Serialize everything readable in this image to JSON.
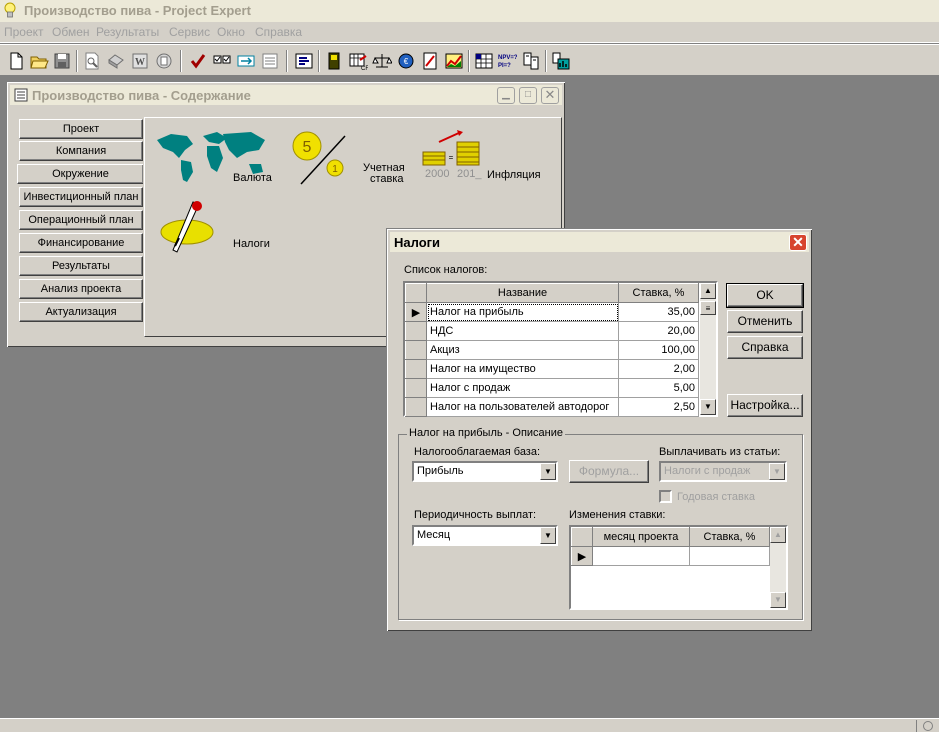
{
  "app": {
    "title": "Производство пива - Project Expert"
  },
  "menu": [
    "Проект",
    "Обмен",
    "Результаты",
    "Сервис",
    "Окно",
    "Справка"
  ],
  "toolbar_icons": [
    "new-icon",
    "open-icon",
    "save-icon",
    "preview-icon",
    "print-icon",
    "word-icon",
    "excel-icon",
    "check-icon",
    "checklist-icon",
    "calculate-icon",
    "notes-icon",
    "schedule-icon",
    "book-icon",
    "cashflow-icon",
    "balance-icon",
    "financial-icon",
    "results-icon",
    "chart-icon",
    "grid-icon",
    "npv-pi-icon",
    "gauge-icon",
    "dashboard-icon"
  ],
  "content_window": {
    "title": "Производство пива - Содержание",
    "nav": [
      "Проект",
      "Компания",
      "Окружение",
      "Инвестиционный план",
      "Операционный план",
      "Финансирование",
      "Результаты",
      "Анализ проекта",
      "Актуализация"
    ],
    "selected_index": 2,
    "panel": {
      "currency_label": "Валюта",
      "discount_label_1": "Учетная",
      "discount_label_2": "ставка",
      "inflation_label": "Инфляция",
      "year_start": "2000",
      "year_end": "201_",
      "coin_big": "5",
      "coin_small": "1",
      "taxes_label": "Налоги"
    }
  },
  "tax_dialog": {
    "title": "Налоги",
    "list_label": "Список налогов:",
    "columns": [
      "Название",
      "Ставка, %"
    ],
    "rows": [
      {
        "name": "Налог на прибыль",
        "rate": "35,00"
      },
      {
        "name": "НДС",
        "rate": "20,00"
      },
      {
        "name": "Акциз",
        "rate": "100,00"
      },
      {
        "name": "Налог на имущество",
        "rate": "2,00"
      },
      {
        "name": "Налог с продаж",
        "rate": "5,00"
      },
      {
        "name": "Налог на пользователей автодорог",
        "rate": "2,50"
      }
    ],
    "buttons": {
      "ok": "OK",
      "cancel": "Отменить",
      "help": "Справка",
      "settings": "Настройка..."
    },
    "desc_group": "Налог на прибыль - Описание",
    "tax_base_label": "Налогооблагаемая база:",
    "tax_base_value": "Прибыль",
    "formula_btn": "Формула...",
    "pay_from_label": "Выплачивать из статьи:",
    "pay_from_value": "Налоги с продаж",
    "annual_rate_label": "Годовая ставка",
    "periodicity_label": "Периодичность выплат:",
    "periodicity_value": "Месяц",
    "rate_changes_label": "Изменения ставки:",
    "rate_columns": [
      "месяц проекта",
      "Ставка, %"
    ]
  }
}
